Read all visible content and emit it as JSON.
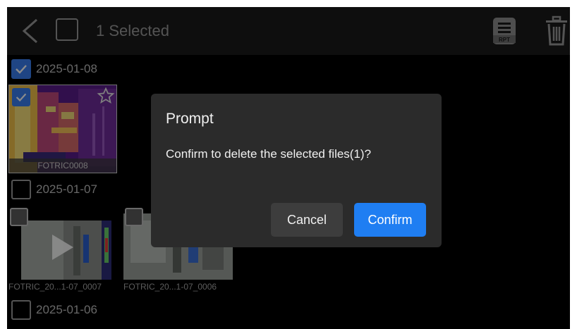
{
  "header": {
    "selected_text": "1 Selected",
    "rpt_label": "RPT"
  },
  "groups": [
    {
      "date": "2025-01-08",
      "checked": true,
      "items": [
        {
          "name": "FOTRIC0008",
          "checked": true,
          "favorite": true
        }
      ]
    },
    {
      "date": "2025-01-07",
      "checked": false,
      "items": [
        {
          "name": "FOTRIC_20...1-07_0007",
          "checked": false
        },
        {
          "name": "FOTRIC_20...1-07_0006",
          "checked": false
        }
      ]
    },
    {
      "date": "2025-01-06",
      "checked": false,
      "items": []
    }
  ],
  "dialog": {
    "title": "Prompt",
    "message": "Confirm to delete the selected files(1)?",
    "cancel_label": "Cancel",
    "confirm_label": "Confirm"
  },
  "colors": {
    "accent": "#1f7ef2",
    "checkbox_checked": "#3a7ff0",
    "dialog_bg": "#2b2b2b",
    "topbar_bg": "#1a1a1a"
  }
}
